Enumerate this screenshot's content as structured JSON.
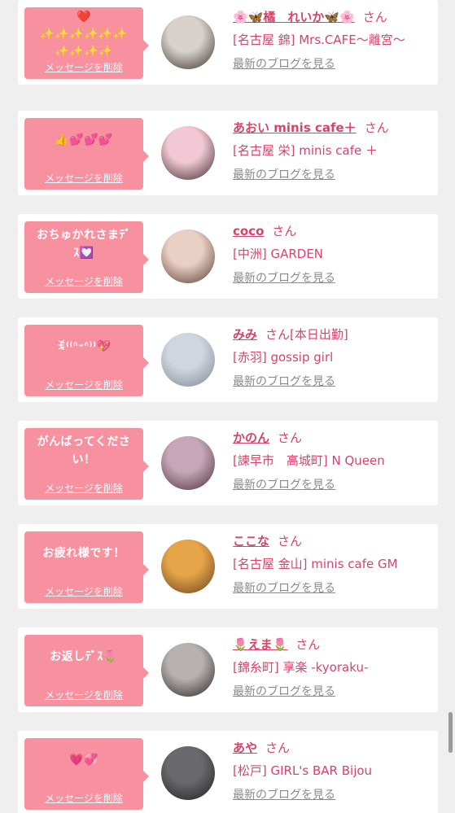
{
  "actions": {
    "delete_label": "メッセージを削除",
    "blog_label": "最新のブログを見る",
    "honorific": "さん"
  },
  "items": [
    {
      "message": "❤️\n✨✨✨✨✨✨\n✨✨✨✨",
      "name": "🌸🦋橘　れいか🦋🌸",
      "extra": "",
      "shop": "[名古屋 錦] Mrs.CAFE〜離宮〜",
      "avatar_colors": [
        "#d9d2cc",
        "#3a2e2a"
      ]
    },
    {
      "message": "👍💕💕💕",
      "name": "あおい minis cafe＋",
      "extra": "",
      "shop": "[名古屋 栄] minis cafe ＋",
      "avatar_colors": [
        "#f3c8d6",
        "#3b2a28"
      ]
    },
    {
      "message": "おちゅかれさまﾃﾞ\nｽ💟",
      "name": "coco",
      "extra": "",
      "shop": "[中洲] GARDEN",
      "avatar_colors": [
        "#e9cfc4",
        "#5a3b30"
      ]
    },
    {
      "message": "ꉂ⁽⁽ᐢᵕᐢ⁾⁾💖",
      "name": "みみ",
      "extra": "[本日出勤]",
      "shop": "[赤羽] gossip girl",
      "avatar_colors": [
        "#cfd6de",
        "#7d8794"
      ]
    },
    {
      "message": "がんばってくださ\nい！",
      "name": "かのん",
      "extra": "",
      "shop": "[諫早市　高城町] N Queen",
      "avatar_colors": [
        "#c7a7b7",
        "#4b2f3a"
      ]
    },
    {
      "message": "お疲れ様です！",
      "name": "ここな",
      "extra": "",
      "shop": "[名古屋 金山] minis cafe GM",
      "avatar_colors": [
        "#e5a548",
        "#6b3f1f"
      ]
    },
    {
      "message": "お返しﾃﾞｽ🌷",
      "name": "🌷えま🌷",
      "extra": "",
      "shop": "[錦糸町] 享楽 -kyoraku-",
      "avatar_colors": [
        "#b8b1b1",
        "#2a2424"
      ]
    },
    {
      "message": "💗💞",
      "name": "あや",
      "extra": "",
      "shop": "[松戸] GIRL's BAR Bijou",
      "avatar_colors": [
        "#6a6a6e",
        "#1f1f22"
      ]
    }
  ]
}
